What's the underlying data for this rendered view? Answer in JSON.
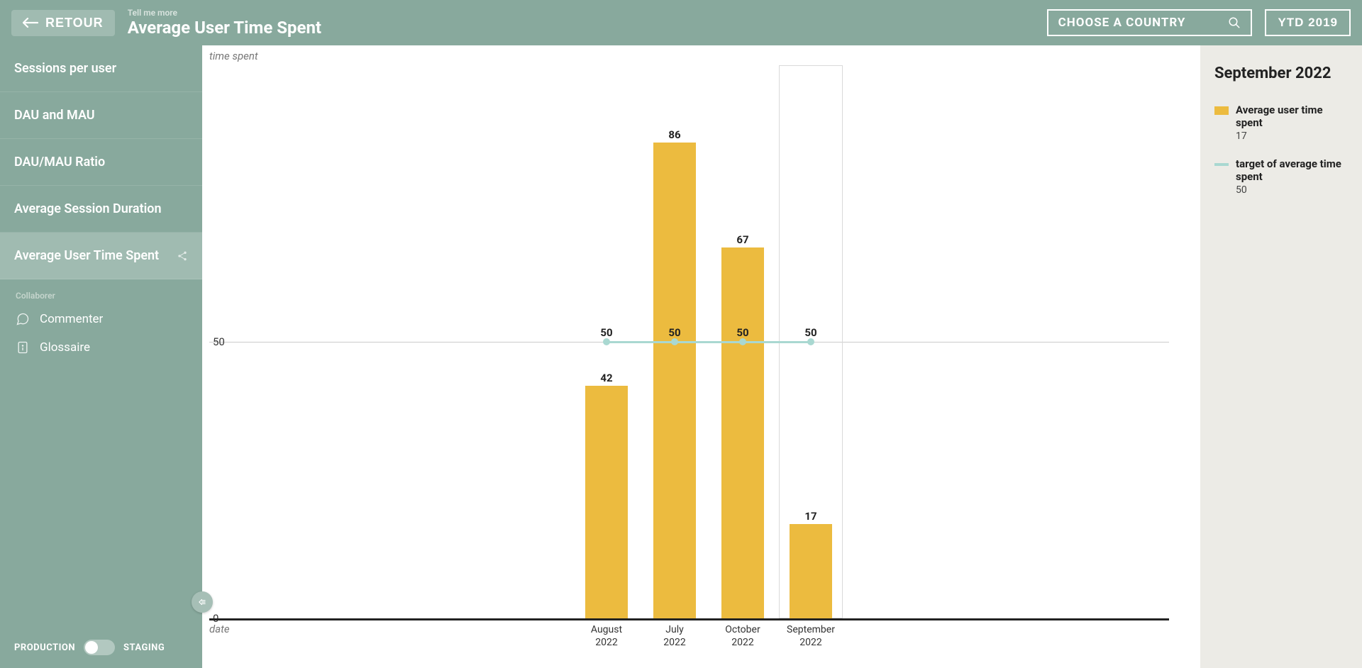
{
  "header": {
    "back_label": "RETOUR",
    "tell_more": "Tell me more",
    "title": "Average User Time Spent",
    "country_placeholder": "CHOOSE A COUNTRY",
    "ytd_label": "YTD 2019"
  },
  "sidebar": {
    "items": [
      {
        "label": "Sessions per user"
      },
      {
        "label": "DAU and MAU"
      },
      {
        "label": "DAU/MAU Ratio"
      },
      {
        "label": "Average Session Duration"
      },
      {
        "label": "Average User Time Spent"
      }
    ],
    "collab_label": "Collaborer",
    "commenter_label": "Commenter",
    "glossaire_label": "Glossaire",
    "production_label": "PRODUCTION",
    "staging_label": "STAGING"
  },
  "info": {
    "title": "September 2022",
    "legend": [
      {
        "name": "Average user time spent",
        "value": "17"
      },
      {
        "name": "target of average time spent",
        "value": "50"
      }
    ]
  },
  "chart_data": {
    "type": "bar",
    "ylabel": "time spent",
    "xlabel": "date",
    "categories": [
      "August 2022",
      "July 2022",
      "October 2022",
      "September 2022"
    ],
    "series": [
      {
        "name": "Average user time spent",
        "type": "bar",
        "values": [
          42,
          86,
          67,
          17
        ]
      },
      {
        "name": "target of average time spent",
        "type": "line",
        "values": [
          50,
          50,
          50,
          50
        ]
      }
    ],
    "yticks": [
      0,
      50
    ],
    "ylim": [
      0,
      100
    ],
    "highlighted_index": 3
  }
}
